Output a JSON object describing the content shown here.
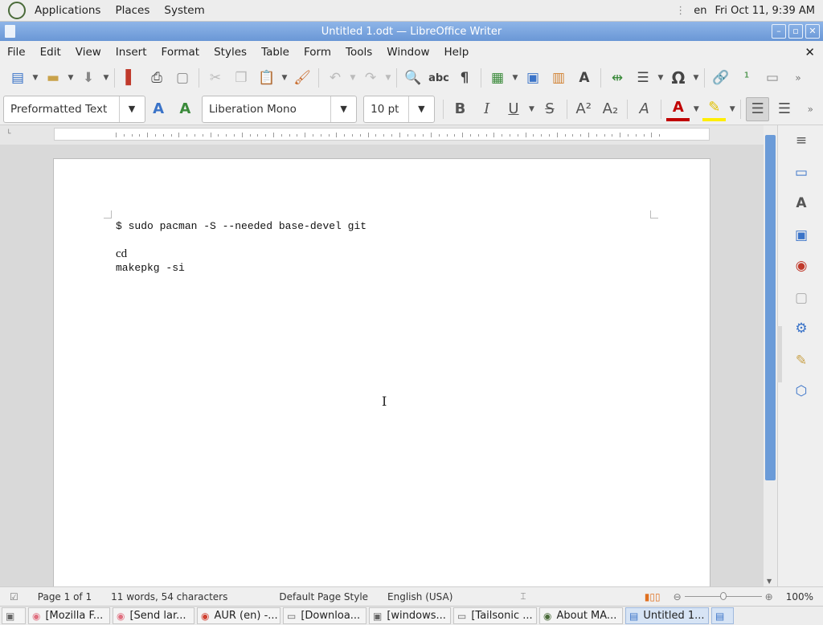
{
  "top_panel": {
    "menus": [
      "Applications",
      "Places",
      "System"
    ],
    "keyboard_layout": "en",
    "clock": "Fri Oct 11,  9:39 AM"
  },
  "window": {
    "title": "Untitled 1.odt — LibreOffice Writer"
  },
  "menubar": {
    "items": [
      "File",
      "Edit",
      "View",
      "Insert",
      "Format",
      "Styles",
      "Table",
      "Form",
      "Tools",
      "Window",
      "Help"
    ],
    "close_doc": "✕"
  },
  "formatting": {
    "paragraph_style": "Preformatted Text",
    "font_name": "Liberation Mono",
    "font_size": "10 pt"
  },
  "document": {
    "lines": [
      "$ sudo pacman -S --needed base-devel git",
      "cd",
      "makepkg -si"
    ]
  },
  "statusbar": {
    "page": "Page 1 of 1",
    "word_count": "11 words, 54 characters",
    "page_style": "Default Page Style",
    "language": "English (USA)",
    "zoom": "100%"
  },
  "taskbar": {
    "tasks": [
      "[Mozilla F...",
      "[Send lar...",
      "AUR (en) -...",
      "[Downloa...",
      "[windows...",
      "[Tailsonic ...",
      "About MA...",
      "Untitled 1..."
    ]
  },
  "colors": {
    "titlebar": "#6a97d6",
    "scroll_thumb": "#6b9bd8",
    "page": "#ffffff"
  }
}
